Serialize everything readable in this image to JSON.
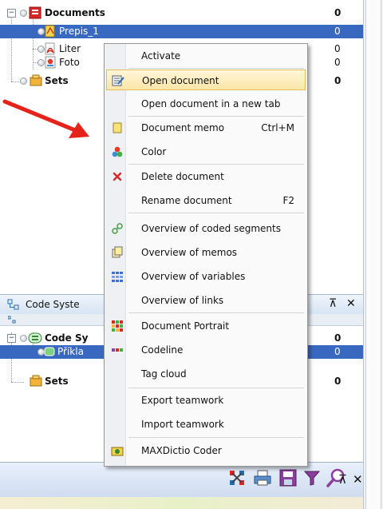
{
  "documents_tree": {
    "root": {
      "label": "Documents",
      "count": "0"
    },
    "items": [
      {
        "label": "Prepis_1",
        "count": "0",
        "selected": true
      },
      {
        "label": "Liter",
        "count": "0",
        "selected": false
      },
      {
        "label": "Foto",
        "count": "0",
        "selected": false
      }
    ],
    "sets": {
      "label": "Sets",
      "count": "0"
    }
  },
  "code_system": {
    "title": "Code Syste",
    "root": {
      "label": "Code Sy",
      "count": "0"
    },
    "items": [
      {
        "label": "Příkla",
        "count": "0",
        "selected": true
      }
    ],
    "sets": {
      "label": "Sets",
      "count": "0"
    }
  },
  "context_menu": {
    "items": [
      {
        "label": "Activate",
        "shortcut": "",
        "icon": "none"
      },
      {
        "label": "Open document",
        "shortcut": "",
        "icon": "open-document-icon",
        "highlighted": true
      },
      {
        "label": "Open document in a new tab",
        "shortcut": "",
        "icon": "none"
      },
      {
        "label": "Document memo",
        "shortcut": "Ctrl+M",
        "icon": "memo-icon"
      },
      {
        "label": "Color",
        "shortcut": "",
        "icon": "color-icon"
      },
      {
        "label": "Delete document",
        "shortcut": "",
        "icon": "delete-x-icon"
      },
      {
        "label": "Rename document",
        "shortcut": "F2",
        "icon": "none"
      },
      {
        "label": "Overview of coded segments",
        "shortcut": "",
        "icon": "coded-segments-icon"
      },
      {
        "label": "Overview of memos",
        "shortcut": "",
        "icon": "memos-overview-icon"
      },
      {
        "label": "Overview of variables",
        "shortcut": "",
        "icon": "variables-grid-icon"
      },
      {
        "label": "Overview of links",
        "shortcut": "",
        "icon": "none"
      },
      {
        "label": "Document Portrait",
        "shortcut": "",
        "icon": "document-portrait-icon"
      },
      {
        "label": "Codeline",
        "shortcut": "",
        "icon": "codeline-icon"
      },
      {
        "label": "Tag cloud",
        "shortcut": "",
        "icon": "none"
      },
      {
        "label": "Export teamwork",
        "shortcut": "",
        "icon": "none"
      },
      {
        "label": "Import teamwork",
        "shortcut": "",
        "icon": "none"
      },
      {
        "label": "MAXDictio Coder",
        "shortcut": "",
        "icon": "maxdictio-icon"
      }
    ]
  },
  "colors": {
    "selection": "#3868c0",
    "menu_highlight": "#fbe6a8",
    "arrow": "#e5231b"
  }
}
